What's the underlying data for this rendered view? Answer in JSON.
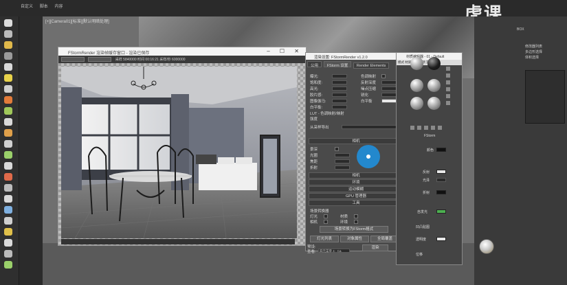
{
  "top_menu": [
    "自定义",
    "脚本",
    "内容"
  ],
  "viewport": {
    "label": "[+][Camera01][标准][默认明暗处理]"
  },
  "frame_buffer": {
    "title": "FStormRender 渲染帧缓存窗口 - 渲染已保存",
    "toolbar_left": "要渲染区域",
    "toolbar_select": "视图",
    "toolbar_info": "采样 5840000 时间 00:16:21 采样/秒 6000000"
  },
  "render_settings": {
    "title": "渲染设置: FStormRender v1.2.0",
    "tabs": [
      "公用",
      "FStorm 设置",
      "Render Elements"
    ],
    "rows_left": [
      "曝光:",
      "饱和度:",
      "高光:",
      "胶片感:",
      "图像伽马:",
      "白平衡:"
    ],
    "rows_right": [
      "色调映射",
      "反射深度",
      "噪点压缩",
      "锐化",
      "白平衡"
    ],
    "lut_label": "LUT - 色调映射/映射",
    "lut_value": "强度",
    "environment_label": "渲染环境:",
    "environment_value": "",
    "preset_label": "从采样导出",
    "camera_section": "相机",
    "camera_rows": [
      "景深",
      "光圈",
      "焦距",
      "折射"
    ],
    "rollouts": [
      "相机",
      "环境",
      "运动模糊",
      "GPU 管理器",
      "工具"
    ],
    "tools_label": "场景转换器",
    "tools_items": [
      "灯光",
      "材质",
      "相机",
      "环境"
    ],
    "tools_button": "场景转换为FStorm格式",
    "buttons": [
      "灯光列表",
      "对象属性",
      "全局覆盖"
    ],
    "preset_bottom_label": "预设:",
    "view_label": "查看:",
    "view_value": "四元菜单 4 - Ca",
    "render_button": "渲染"
  },
  "material_editor": {
    "title": "材质编辑器 - 01 - Default",
    "menu": "模式 材质 导航 选项 实用程序",
    "labels": [
      "FStorm",
      "颜色",
      "反射",
      "光泽",
      "折射",
      "自发光",
      "凹凸贴图",
      "透明度",
      "位移"
    ],
    "swatch_green": "#4caf50",
    "swatch_white": "#e8e8e8",
    "swatch_black": "#111111"
  },
  "right_panel": {
    "header": "BOX",
    "items": [
      "修改器列表",
      "多边形选择",
      "体积选择"
    ]
  },
  "logo": "虎课"
}
